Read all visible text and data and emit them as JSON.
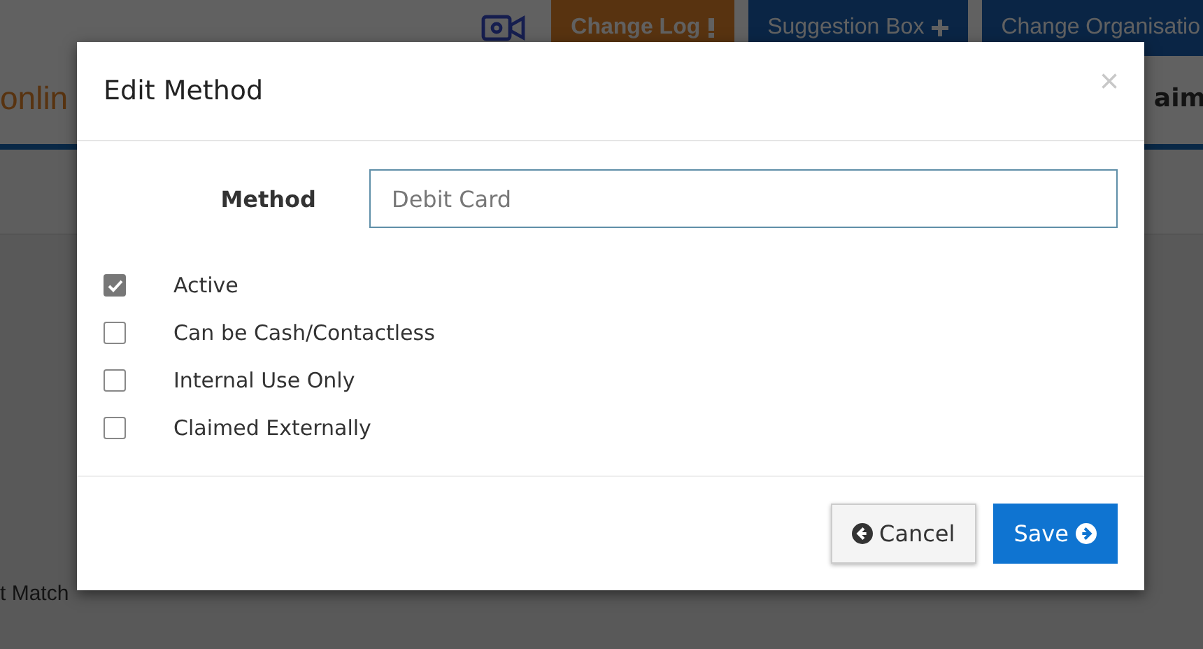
{
  "page": {
    "logo": "onlin",
    "header_buttons": [
      {
        "label": "Change Log",
        "kind": "log"
      },
      {
        "label": "Suggestion Box",
        "kind": "suggest"
      },
      {
        "label": "Change Organisatio",
        "kind": "org"
      }
    ],
    "nav_fragment": "aim",
    "row_fragment": "t Match"
  },
  "dialog": {
    "title": "Edit Method",
    "close": "×",
    "field": {
      "label": "Method",
      "value": "Debit Card"
    },
    "options": [
      {
        "label": "Active",
        "checked": true
      },
      {
        "label": "Can be Cash/Contactless",
        "checked": false
      },
      {
        "label": "Internal Use Only",
        "checked": false
      },
      {
        "label": "Claimed Externally",
        "checked": false
      }
    ],
    "buttons": [
      {
        "label": "Cancel",
        "kind": "cancel"
      },
      {
        "label": "Save",
        "kind": "save"
      }
    ]
  }
}
